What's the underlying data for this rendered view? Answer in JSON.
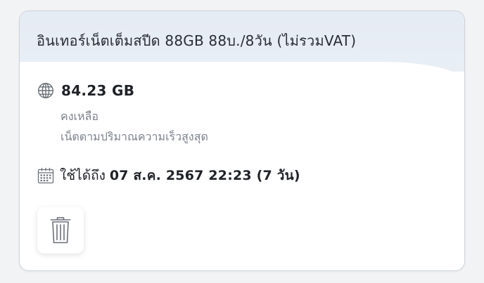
{
  "package": {
    "title": "อินเทอร์เน็ตเต็มสปีด 88GB 88บ./8วัน (ไม่รวมVAT)"
  },
  "data_balance": {
    "amount": "84.23 GB",
    "remaining_label": "คงเหลือ",
    "speed_label": "เน็ตตามปริมาณความเร็วสูงสุด",
    "icon": "globe-icon"
  },
  "expiry": {
    "label": "ใช้ได้ถึง",
    "value": "07 ส.ค. 2567 22:23 (7 วัน)",
    "icon": "calendar-icon"
  },
  "actions": {
    "delete_icon": "trash-icon"
  },
  "colors": {
    "header_bg": "#e6ecf4",
    "text_primary": "#1f2227",
    "text_secondary": "#7d838c",
    "icon_gray": "#6b7078"
  }
}
